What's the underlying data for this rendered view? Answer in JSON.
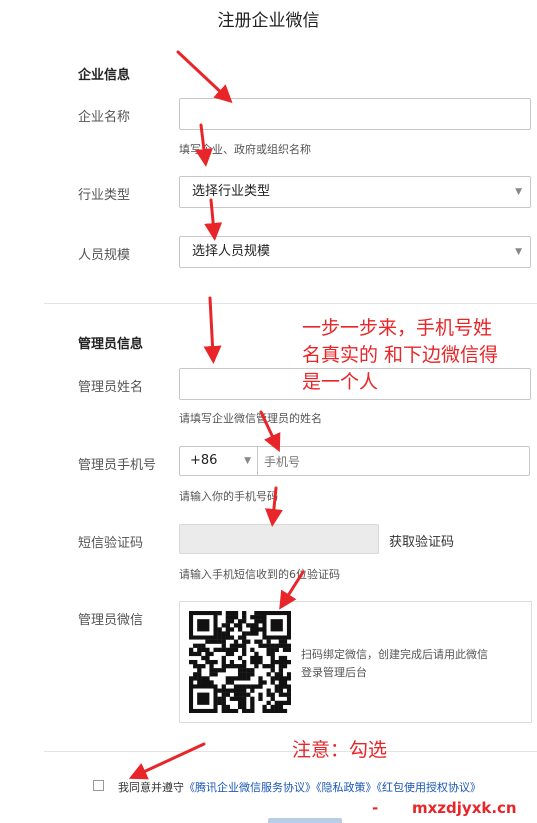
{
  "page_title": "注册企业微信",
  "company_section": {
    "heading": "企业信息",
    "name_label": "企业名称",
    "name_value": "",
    "name_hint": "填写企业、政府或组织名称",
    "industry_label": "行业类型",
    "industry_value": "选择行业类型",
    "size_label": "人员规模",
    "size_value": "选择人员规模"
  },
  "admin_section": {
    "heading": "管理员信息",
    "name_label": "管理员姓名",
    "name_value": "",
    "name_hint": "请填写企业微信管理员的姓名",
    "phone_label": "管理员手机号",
    "country_code": "+86",
    "phone_placeholder": "手机号",
    "phone_hint": "请输入你的手机号码",
    "sms_label": "短信验证码",
    "sms_value": "",
    "sms_button": "获取验证码",
    "sms_hint": "请输入手机短信收到的6位验证码",
    "wechat_label": "管理员微信",
    "qr_text_line1": "扫码绑定微信，创建完成后请用此微信",
    "qr_text_line2": "登录管理后台"
  },
  "annotations": {
    "note1_line1": "一步一步来，手机号姓",
    "note1_line2": "名真实的 和下边微信得",
    "note1_line3": "是一个人",
    "note2": "注意：勾选"
  },
  "agreement": {
    "checked": false,
    "prefix": "我同意并遵守",
    "link1": "《腾讯企业微信服务协议》",
    "link2": "《隐私政策》",
    "link3": "《红包使用授权协议》"
  },
  "watermark": {
    "dash": "-",
    "text": "mxzdjyxk.cn"
  },
  "colors": {
    "annotation_red": "#e8262a",
    "link_blue": "#1a57b3"
  }
}
